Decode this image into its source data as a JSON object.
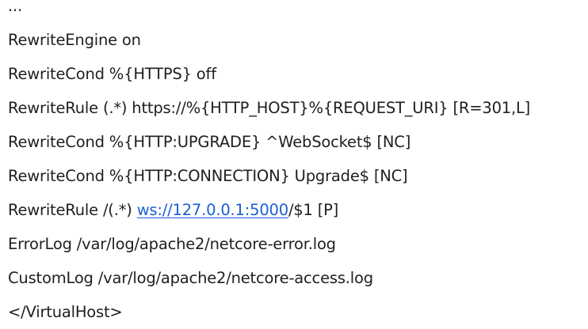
{
  "lines": [
    {
      "text": "..."
    },
    {
      "text": "RewriteEngine on"
    },
    {
      "text": "RewriteCond %{HTTPS} off"
    },
    {
      "text": "RewriteRule (.*) https://%{HTTP_HOST}%{REQUEST_URI} [R=301,L]"
    },
    {
      "text": "RewriteCond %{HTTP:UPGRADE} ^WebSocket$ [NC]"
    },
    {
      "text": "RewriteCond %{HTTP:CONNECTION} Upgrade$ [NC]"
    },
    {
      "before": "RewriteRule /(.*) ",
      "link": "ws://127.0.0.1:5000",
      "after": "/$1 [P]"
    },
    {
      "text": "ErrorLog /var/log/apache2/netcore-error.log"
    },
    {
      "text": "CustomLog /var/log/apache2/netcore-access.log"
    },
    {
      "text": "</VirtualHost>"
    }
  ],
  "colors": {
    "text": "#1f1f1f",
    "link": "#1a5fd6",
    "background": "#ffffff"
  }
}
